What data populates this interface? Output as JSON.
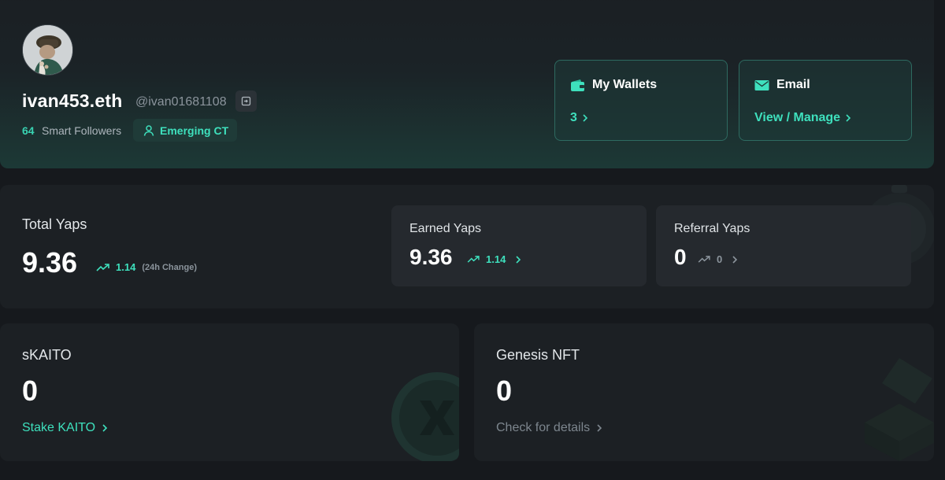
{
  "profile": {
    "username": "ivan453.eth",
    "handle": "@ivan01681108",
    "smart_followers_count": "64",
    "smart_followers_label": "Smart Followers",
    "tier_badge": "Emerging CT",
    "wallets": {
      "title": "My Wallets",
      "value": "3"
    },
    "email": {
      "title": "Email",
      "link": "View / Manage"
    }
  },
  "yaps": {
    "total": {
      "label": "Total Yaps",
      "value": "9.36",
      "change": "1.14",
      "change_note": "(24h Change)"
    },
    "earned": {
      "label": "Earned Yaps",
      "value": "9.36",
      "change": "1.14"
    },
    "referral": {
      "label": "Referral Yaps",
      "value": "0",
      "change": "0"
    }
  },
  "skaito": {
    "label": "sKAITO",
    "value": "0",
    "link": "Stake KAITO"
  },
  "genesis": {
    "label": "Genesis NFT",
    "value": "0",
    "link": "Check for details"
  },
  "colors": {
    "accent": "#3ee0bd",
    "background": "#16191d",
    "card": "#1c2024",
    "muted": "#8b949c"
  },
  "icons": [
    "wallet-icon",
    "mail-icon",
    "user-icon",
    "copy-icon",
    "trend-up-icon",
    "chevron-right-icon"
  ]
}
